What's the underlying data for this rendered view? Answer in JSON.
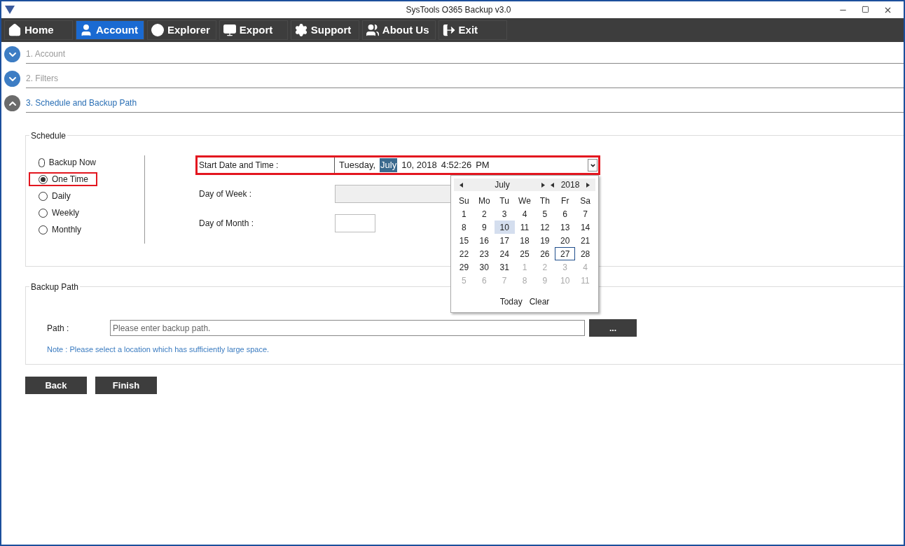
{
  "window": {
    "title": "SysTools O365 Backup v3.0"
  },
  "toolbar": [
    {
      "label": "Home",
      "selected": false
    },
    {
      "label": "Account",
      "selected": true
    },
    {
      "label": "Explorer",
      "selected": false
    },
    {
      "label": "Export",
      "selected": false
    },
    {
      "label": "Support",
      "selected": false
    },
    {
      "label": "About Us",
      "selected": false
    },
    {
      "label": "Exit",
      "selected": false
    }
  ],
  "steps": [
    {
      "label": "1. Account",
      "expanded": false
    },
    {
      "label": "2. Filters",
      "expanded": false
    },
    {
      "label": "3. Schedule and Backup Path",
      "expanded": true
    }
  ],
  "schedule": {
    "title": "Schedule",
    "options": [
      {
        "label": "Backup Now",
        "selected": false,
        "highlighted": false
      },
      {
        "label": "One Time",
        "selected": true,
        "highlighted": true
      },
      {
        "label": "Daily",
        "selected": false,
        "highlighted": false
      },
      {
        "label": "Weekly",
        "selected": false,
        "highlighted": false
      },
      {
        "label": "Monthly",
        "selected": false,
        "highlighted": false
      }
    ],
    "start": {
      "label": "Start Date and Time :",
      "highlighted": true,
      "segments": [
        {
          "text": "Tuesday,",
          "selected": false
        },
        {
          "text": "July",
          "selected": true
        },
        {
          "text": "10, 2018",
          "selected": false
        },
        {
          "text": "4:52:26",
          "selected": false
        },
        {
          "text": "PM",
          "selected": false
        }
      ]
    },
    "day_of_week": {
      "label": "Day  of Week :",
      "disabled": true
    },
    "day_of_month": {
      "label": "Day  of  Month :"
    }
  },
  "calendar": {
    "month": "July",
    "year": "2018",
    "weekdays": [
      "Su",
      "Mo",
      "Tu",
      "We",
      "Th",
      "Fr",
      "Sa"
    ],
    "weeks": [
      [
        {
          "day": "1",
          "kind": "current",
          "selected": false,
          "today": false
        },
        {
          "day": "2",
          "kind": "current",
          "selected": false,
          "today": false
        },
        {
          "day": "3",
          "kind": "current",
          "selected": false,
          "today": false
        },
        {
          "day": "4",
          "kind": "current",
          "selected": false,
          "today": false
        },
        {
          "day": "5",
          "kind": "current",
          "selected": false,
          "today": false
        },
        {
          "day": "6",
          "kind": "current",
          "selected": false,
          "today": false
        },
        {
          "day": "7",
          "kind": "current",
          "selected": false,
          "today": false
        }
      ],
      [
        {
          "day": "8",
          "kind": "current",
          "selected": false,
          "today": false
        },
        {
          "day": "9",
          "kind": "current",
          "selected": false,
          "today": false
        },
        {
          "day": "10",
          "kind": "current",
          "selected": true,
          "today": false
        },
        {
          "day": "11",
          "kind": "current",
          "selected": false,
          "today": false
        },
        {
          "day": "12",
          "kind": "current",
          "selected": false,
          "today": false
        },
        {
          "day": "13",
          "kind": "current",
          "selected": false,
          "today": false
        },
        {
          "day": "14",
          "kind": "current",
          "selected": false,
          "today": false
        }
      ],
      [
        {
          "day": "15",
          "kind": "current",
          "selected": false,
          "today": false
        },
        {
          "day": "16",
          "kind": "current",
          "selected": false,
          "today": false
        },
        {
          "day": "17",
          "kind": "current",
          "selected": false,
          "today": false
        },
        {
          "day": "18",
          "kind": "current",
          "selected": false,
          "today": false
        },
        {
          "day": "19",
          "kind": "current",
          "selected": false,
          "today": false
        },
        {
          "day": "20",
          "kind": "current",
          "selected": false,
          "today": false
        },
        {
          "day": "21",
          "kind": "current",
          "selected": false,
          "today": false
        }
      ],
      [
        {
          "day": "22",
          "kind": "current",
          "selected": false,
          "today": false
        },
        {
          "day": "23",
          "kind": "current",
          "selected": false,
          "today": false
        },
        {
          "day": "24",
          "kind": "current",
          "selected": false,
          "today": false
        },
        {
          "day": "25",
          "kind": "current",
          "selected": false,
          "today": false
        },
        {
          "day": "26",
          "kind": "current",
          "selected": false,
          "today": false
        },
        {
          "day": "27",
          "kind": "current",
          "selected": false,
          "today": true
        },
        {
          "day": "28",
          "kind": "current",
          "selected": false,
          "today": false
        }
      ],
      [
        {
          "day": "29",
          "kind": "current",
          "selected": false,
          "today": false
        },
        {
          "day": "30",
          "kind": "current",
          "selected": false,
          "today": false
        },
        {
          "day": "31",
          "kind": "current",
          "selected": false,
          "today": false
        },
        {
          "day": "1",
          "kind": "other",
          "selected": false,
          "today": false
        },
        {
          "day": "2",
          "kind": "other",
          "selected": false,
          "today": false
        },
        {
          "day": "3",
          "kind": "other",
          "selected": false,
          "today": false
        },
        {
          "day": "4",
          "kind": "other",
          "selected": false,
          "today": false
        }
      ],
      [
        {
          "day": "5",
          "kind": "other",
          "selected": false,
          "today": false
        },
        {
          "day": "6",
          "kind": "other",
          "selected": false,
          "today": false
        },
        {
          "day": "7",
          "kind": "other",
          "selected": false,
          "today": false
        },
        {
          "day": "8",
          "kind": "other",
          "selected": false,
          "today": false
        },
        {
          "day": "9",
          "kind": "other",
          "selected": false,
          "today": false
        },
        {
          "day": "10",
          "kind": "other",
          "selected": false,
          "today": false
        },
        {
          "day": "11",
          "kind": "other",
          "selected": false,
          "today": false
        }
      ]
    ],
    "buttons": [
      "Today",
      "Clear"
    ]
  },
  "backup_path": {
    "title": "Backup Path",
    "label": "Path :",
    "placeholder": "Please enter backup path.",
    "browse": "...",
    "note": "Note : Please select a location which has sufficiently large space."
  },
  "buttons": [
    "Back",
    "Finish"
  ]
}
